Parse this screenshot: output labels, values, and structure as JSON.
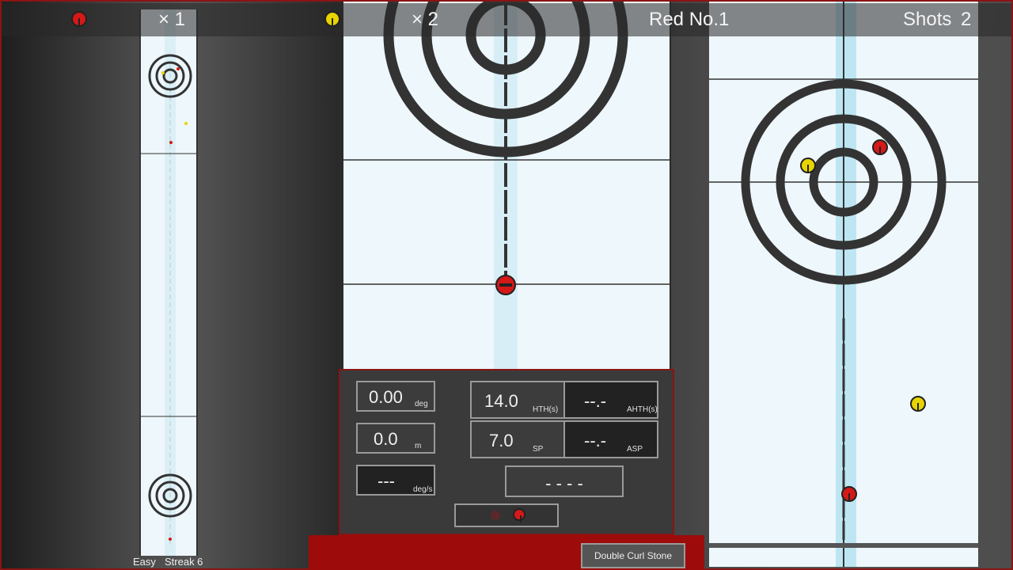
{
  "scoreboard": {
    "red_count": "× 1",
    "yellow_count": "× 2",
    "current_shooter": "Red No.1",
    "shots_label": "Shots",
    "shots_value": "2"
  },
  "controls": {
    "angle_value": "0.00",
    "angle_unit": "deg",
    "offset_value": "0.0",
    "offset_unit": "m",
    "spin_value": "---",
    "spin_unit": "deg/s",
    "hth_value": "14.0",
    "hth_label": "HTH(s)",
    "ahth_value": "--.-",
    "ahth_label": "AHTH(s)",
    "sp_value": "7.0",
    "sp_label": "SP",
    "asp_value": "--.-",
    "asp_label": "ASP",
    "result_value": "- - - -"
  },
  "footer": {
    "difficulty": "Easy",
    "streak": "Streak 6",
    "button_label": "Double Curl Stone"
  },
  "colors": {
    "red_team": "#d51818",
    "yellow_team": "#e8d400",
    "frame": "#8a1414"
  },
  "icons": {
    "red_team": "red-stone-icon",
    "yellow_team": "yellow-stone-icon"
  }
}
